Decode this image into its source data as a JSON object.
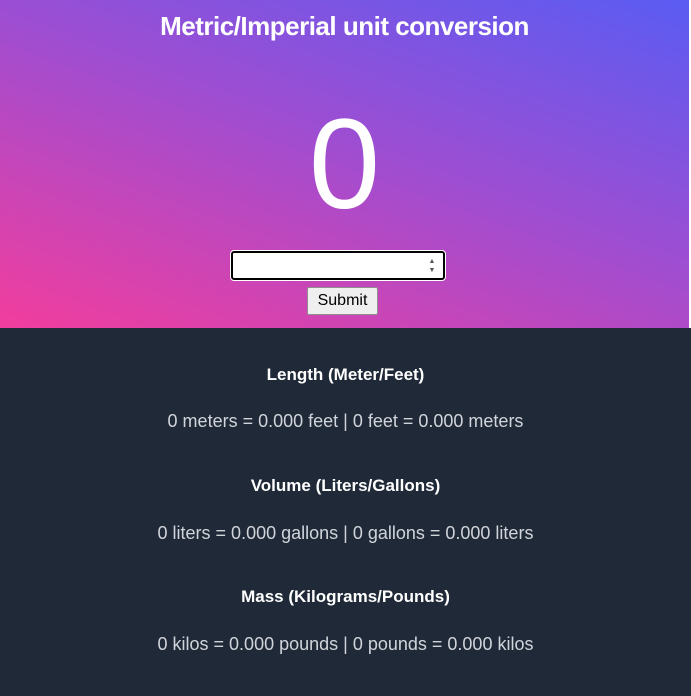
{
  "header": {
    "title": "Metric/Imperial unit conversion",
    "value": "0"
  },
  "form": {
    "input_value": "",
    "submit_label": "Submit"
  },
  "sections": [
    {
      "heading": "Length (Meter/Feet)",
      "text": "0 meters = 0.000 feet | 0 feet = 0.000 meters"
    },
    {
      "heading": "Volume (Liters/Gallons)",
      "text": "0 liters = 0.000 gallons | 0 gallons = 0.000 liters"
    },
    {
      "heading": "Mass (Kilograms/Pounds)",
      "text": "0 kilos = 0.000 pounds | 0 pounds = 0.000 kilos"
    }
  ],
  "colors": {
    "gradient_start": "#5a5cf3",
    "gradient_mid": "#a14dd0",
    "gradient_end": "#f23d9d",
    "results_background": "#1f2937"
  },
  "icons": {
    "spinner_up": "triangle-up-icon",
    "spinner_down": "triangle-down-icon"
  }
}
